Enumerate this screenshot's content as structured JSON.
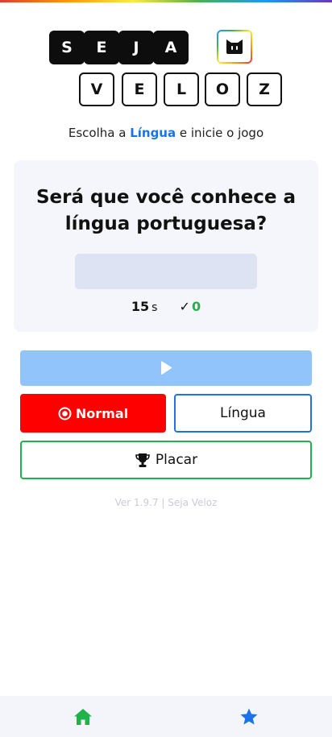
{
  "logo": {
    "word1": [
      "S",
      "E",
      "J",
      "A"
    ],
    "word2": [
      "V",
      "E",
      "L",
      "O",
      "Z"
    ]
  },
  "subtitle": {
    "prefix": "Escolha a",
    "highlight": "Língua",
    "suffix": "e inicie o jogo"
  },
  "card": {
    "question_line1": "Será que você conhece a",
    "question_line2": "língua portuguesa?",
    "timer_value": "15",
    "timer_unit": "s",
    "score_value": "0"
  },
  "buttons": {
    "play_icon": "play-icon",
    "normal_label": "Normal",
    "lingua_label": "Língua",
    "placar_label": "Placar"
  },
  "footer": {
    "version": "Ver 1.9.7 | Seja Veloz"
  },
  "nav": {
    "home_icon": "home-icon",
    "favorites_icon": "star-icon"
  },
  "colors": {
    "primary_blue": "#1a73e8",
    "play_disabled": "#90c4fb",
    "normal_red": "#ff0000",
    "success_green": "#1fb34a"
  }
}
